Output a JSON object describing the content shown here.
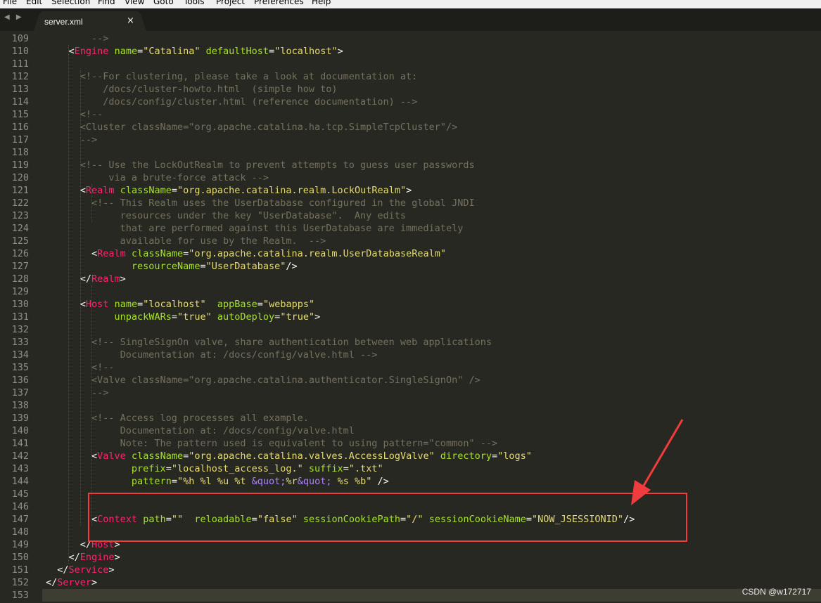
{
  "menu": [
    "File",
    "Edit",
    "Selection",
    "Find",
    "View",
    "Goto",
    "Tools",
    "Project",
    "Preferences",
    "Help"
  ],
  "nav_arrows": "◀ ▶",
  "tab": {
    "title": "server.xml",
    "close": "×"
  },
  "watermark": "CSDN @w172717",
  "icons": {
    "nav_back": "arrow-left-icon",
    "nav_forward": "arrow-right-icon",
    "tab_close": "close-icon"
  },
  "colors": {
    "background": "#272822",
    "tag": "#f92672",
    "attr": "#a6e22e",
    "string": "#e6db74",
    "comment": "#75715e",
    "highlight": "#f03c3c"
  },
  "lines": [
    {
      "n": "109",
      "t": [
        [
          "com",
          "        -->"
        ]
      ]
    },
    {
      "n": "110",
      "t": [
        [
          "punc",
          "    <"
        ],
        [
          "tag",
          "Engine"
        ],
        [
          "punc",
          " "
        ],
        [
          "attr",
          "name"
        ],
        [
          "punc",
          "="
        ],
        [
          "str",
          "\"Catalina\""
        ],
        [
          "punc",
          " "
        ],
        [
          "attr",
          "defaultHost"
        ],
        [
          "punc",
          "="
        ],
        [
          "str",
          "\"localhost\""
        ],
        [
          "punc",
          ">"
        ]
      ]
    },
    {
      "n": "111",
      "t": []
    },
    {
      "n": "112",
      "t": [
        [
          "com",
          "      <!--For clustering, please take a look at documentation at:"
        ]
      ]
    },
    {
      "n": "113",
      "t": [
        [
          "com",
          "          /docs/cluster-howto.html  (simple how to)"
        ]
      ]
    },
    {
      "n": "114",
      "t": [
        [
          "com",
          "          /docs/config/cluster.html (reference documentation) -->"
        ]
      ]
    },
    {
      "n": "115",
      "t": [
        [
          "com",
          "      <!--"
        ]
      ]
    },
    {
      "n": "116",
      "t": [
        [
          "com",
          "      <Cluster className=\"org.apache.catalina.ha.tcp.SimpleTcpCluster\"/>"
        ]
      ]
    },
    {
      "n": "117",
      "t": [
        [
          "com",
          "      -->"
        ]
      ]
    },
    {
      "n": "118",
      "t": []
    },
    {
      "n": "119",
      "t": [
        [
          "com",
          "      <!-- Use the LockOutRealm to prevent attempts to guess user passwords"
        ]
      ]
    },
    {
      "n": "120",
      "t": [
        [
          "com",
          "           via a brute-force attack -->"
        ]
      ]
    },
    {
      "n": "121",
      "t": [
        [
          "punc",
          "      <"
        ],
        [
          "tag",
          "Realm"
        ],
        [
          "punc",
          " "
        ],
        [
          "attr",
          "className"
        ],
        [
          "punc",
          "="
        ],
        [
          "str",
          "\"org.apache.catalina.realm.LockOutRealm\""
        ],
        [
          "punc",
          ">"
        ]
      ]
    },
    {
      "n": "122",
      "t": [
        [
          "com",
          "        <!-- This Realm uses the UserDatabase configured in the global JNDI"
        ]
      ]
    },
    {
      "n": "123",
      "t": [
        [
          "com",
          "             resources under the key \"UserDatabase\".  Any edits"
        ]
      ]
    },
    {
      "n": "124",
      "t": [
        [
          "com",
          "             that are performed against this UserDatabase are immediately"
        ]
      ]
    },
    {
      "n": "125",
      "t": [
        [
          "com",
          "             available for use by the Realm.  -->"
        ]
      ]
    },
    {
      "n": "126",
      "t": [
        [
          "punc",
          "        <"
        ],
        [
          "tag",
          "Realm"
        ],
        [
          "punc",
          " "
        ],
        [
          "attr",
          "className"
        ],
        [
          "punc",
          "="
        ],
        [
          "str",
          "\"org.apache.catalina.realm.UserDatabaseRealm\""
        ]
      ]
    },
    {
      "n": "127",
      "t": [
        [
          "punc",
          "               "
        ],
        [
          "attr",
          "resourceName"
        ],
        [
          "punc",
          "="
        ],
        [
          "str",
          "\"UserDatabase\""
        ],
        [
          "punc",
          "/>"
        ]
      ]
    },
    {
      "n": "128",
      "t": [
        [
          "punc",
          "      </"
        ],
        [
          "tag",
          "Realm"
        ],
        [
          "punc",
          ">"
        ]
      ]
    },
    {
      "n": "129",
      "t": []
    },
    {
      "n": "130",
      "t": [
        [
          "punc",
          "      <"
        ],
        [
          "tag",
          "Host"
        ],
        [
          "punc",
          " "
        ],
        [
          "attr",
          "name"
        ],
        [
          "punc",
          "="
        ],
        [
          "str",
          "\"localhost\""
        ],
        [
          "punc",
          "  "
        ],
        [
          "attr",
          "appBase"
        ],
        [
          "punc",
          "="
        ],
        [
          "str",
          "\"webapps\""
        ]
      ]
    },
    {
      "n": "131",
      "t": [
        [
          "punc",
          "            "
        ],
        [
          "attr",
          "unpackWARs"
        ],
        [
          "punc",
          "="
        ],
        [
          "str",
          "\"true\""
        ],
        [
          "punc",
          " "
        ],
        [
          "attr",
          "autoDeploy"
        ],
        [
          "punc",
          "="
        ],
        [
          "str",
          "\"true\""
        ],
        [
          "punc",
          ">"
        ]
      ]
    },
    {
      "n": "132",
      "t": []
    },
    {
      "n": "133",
      "t": [
        [
          "com",
          "        <!-- SingleSignOn valve, share authentication between web applications"
        ]
      ]
    },
    {
      "n": "134",
      "t": [
        [
          "com",
          "             Documentation at: /docs/config/valve.html -->"
        ]
      ]
    },
    {
      "n": "135",
      "t": [
        [
          "com",
          "        <!--"
        ]
      ]
    },
    {
      "n": "136",
      "t": [
        [
          "com",
          "        <Valve className=\"org.apache.catalina.authenticator.SingleSignOn\" />"
        ]
      ]
    },
    {
      "n": "137",
      "t": [
        [
          "com",
          "        -->"
        ]
      ]
    },
    {
      "n": "138",
      "t": []
    },
    {
      "n": "139",
      "t": [
        [
          "com",
          "        <!-- Access log processes all example."
        ]
      ]
    },
    {
      "n": "140",
      "t": [
        [
          "com",
          "             Documentation at: /docs/config/valve.html"
        ]
      ]
    },
    {
      "n": "141",
      "t": [
        [
          "com",
          "             Note: The pattern used is equivalent to using pattern=\"common\" -->"
        ]
      ]
    },
    {
      "n": "142",
      "t": [
        [
          "punc",
          "        <"
        ],
        [
          "tag",
          "Valve"
        ],
        [
          "punc",
          " "
        ],
        [
          "attr",
          "className"
        ],
        [
          "punc",
          "="
        ],
        [
          "str",
          "\"org.apache.catalina.valves.AccessLogValve\""
        ],
        [
          "punc",
          " "
        ],
        [
          "attr",
          "directory"
        ],
        [
          "punc",
          "="
        ],
        [
          "str",
          "\"logs\""
        ]
      ]
    },
    {
      "n": "143",
      "t": [
        [
          "punc",
          "               "
        ],
        [
          "attr",
          "prefix"
        ],
        [
          "punc",
          "="
        ],
        [
          "str",
          "\"localhost_access_log.\""
        ],
        [
          "punc",
          " "
        ],
        [
          "attr",
          "suffix"
        ],
        [
          "punc",
          "="
        ],
        [
          "str",
          "\".txt\""
        ]
      ]
    },
    {
      "n": "144",
      "t": [
        [
          "punc",
          "               "
        ],
        [
          "attr",
          "pattern"
        ],
        [
          "punc",
          "="
        ],
        [
          "str",
          "\"%h %l %u %t "
        ],
        [
          "ent",
          "&quot;"
        ],
        [
          "str",
          "%r"
        ],
        [
          "ent",
          "&quot;"
        ],
        [
          "str",
          " %s %b\""
        ],
        [
          "punc",
          " />"
        ]
      ]
    },
    {
      "n": "145",
      "t": []
    },
    {
      "n": "146",
      "t": []
    },
    {
      "n": "147",
      "t": [
        [
          "punc",
          "        <"
        ],
        [
          "tag",
          "Context"
        ],
        [
          "punc",
          " "
        ],
        [
          "attr",
          "path"
        ],
        [
          "punc",
          "="
        ],
        [
          "str",
          "\"\""
        ],
        [
          "punc",
          "  "
        ],
        [
          "attr",
          "reloadable"
        ],
        [
          "punc",
          "="
        ],
        [
          "str",
          "\"false\""
        ],
        [
          "punc",
          " "
        ],
        [
          "attr",
          "sessionCookiePath"
        ],
        [
          "punc",
          "="
        ],
        [
          "str",
          "\"/\""
        ],
        [
          "punc",
          " "
        ],
        [
          "attr",
          "sessionCookieName"
        ],
        [
          "punc",
          "="
        ],
        [
          "str",
          "\"NOW_JSESSIONID\""
        ],
        [
          "punc",
          "/>"
        ]
      ]
    },
    {
      "n": "148",
      "t": []
    },
    {
      "n": "149",
      "t": [
        [
          "punc",
          "      </"
        ],
        [
          "tag",
          "Host"
        ],
        [
          "punc",
          ">"
        ]
      ]
    },
    {
      "n": "150",
      "t": [
        [
          "punc",
          "    </"
        ],
        [
          "tag",
          "Engine"
        ],
        [
          "punc",
          ">"
        ]
      ]
    },
    {
      "n": "151",
      "t": [
        [
          "punc",
          "  </"
        ],
        [
          "tag",
          "Service"
        ],
        [
          "punc",
          ">"
        ]
      ]
    },
    {
      "n": "152",
      "t": [
        [
          "punc",
          "</"
        ],
        [
          "tag",
          "Server"
        ],
        [
          "punc",
          ">"
        ]
      ]
    },
    {
      "n": "153",
      "t": []
    }
  ]
}
